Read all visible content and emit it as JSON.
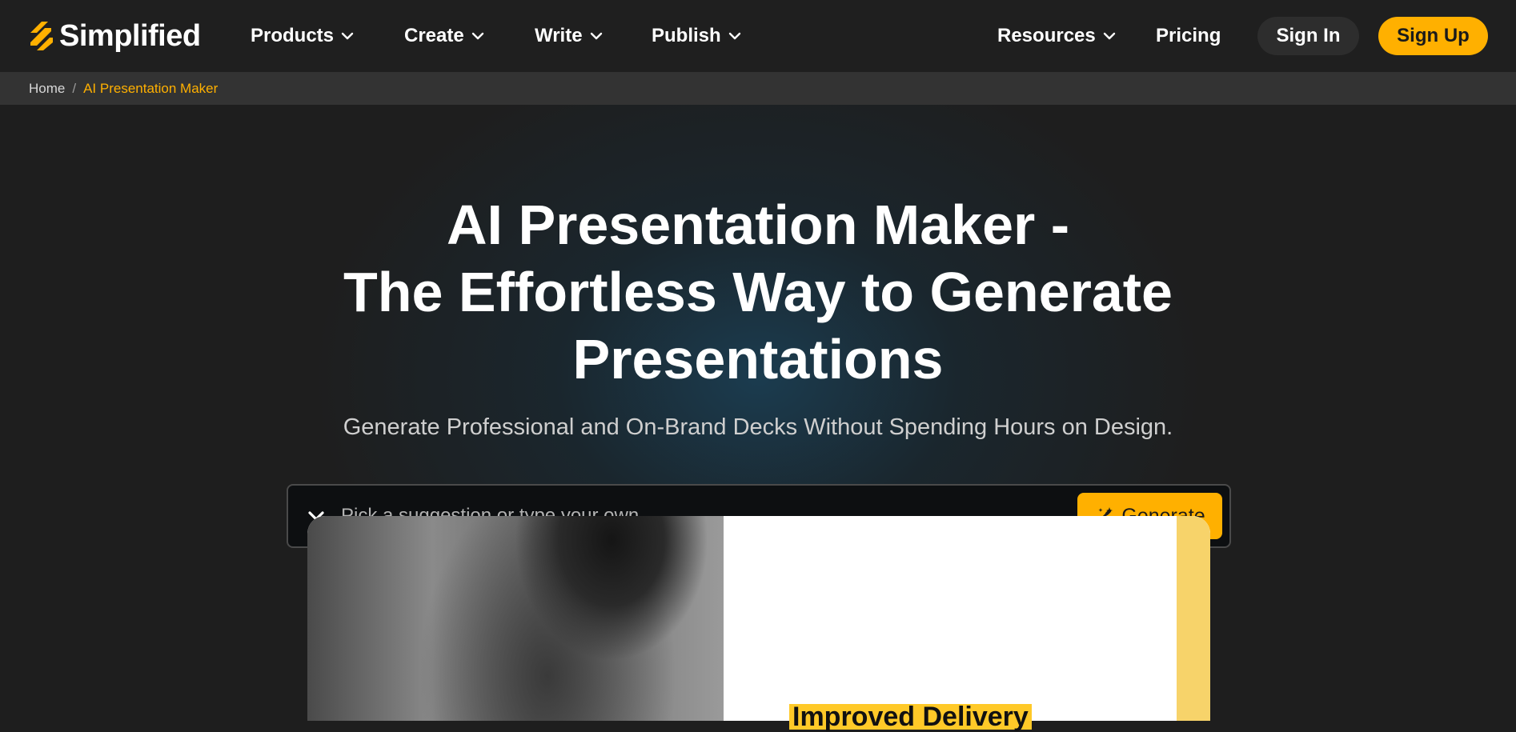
{
  "brand": {
    "name": "Simplified",
    "accent_color": "#ffb000"
  },
  "nav": {
    "items": [
      {
        "label": "Products",
        "icon": "chevron-down-icon"
      },
      {
        "label": "Create",
        "icon": "chevron-down-icon"
      },
      {
        "label": "Write",
        "icon": "chevron-down-icon"
      },
      {
        "label": "Publish",
        "icon": "chevron-down-icon"
      },
      {
        "label": "Resources",
        "icon": "chevron-down-icon"
      },
      {
        "label": "Pricing"
      }
    ],
    "sign_in": "Sign In",
    "sign_up": "Sign Up"
  },
  "breadcrumb": {
    "home": "Home",
    "separator": "/",
    "current": "AI Presentation Maker"
  },
  "hero": {
    "title_lines": [
      "AI Presentation Maker -",
      "The Effortless Way to Generate",
      "Presentations"
    ],
    "subtitle": "Generate Professional and On-Brand Decks Without Spending Hours on Design."
  },
  "prompt": {
    "placeholder": "Pick a suggestion or type your own",
    "value": "",
    "dropdown_icon": "chevron-down-icon",
    "generate_label": "Generate",
    "generate_icon": "magic-wand-icon"
  },
  "preview": {
    "slide_heading": "Improved Delivery"
  }
}
